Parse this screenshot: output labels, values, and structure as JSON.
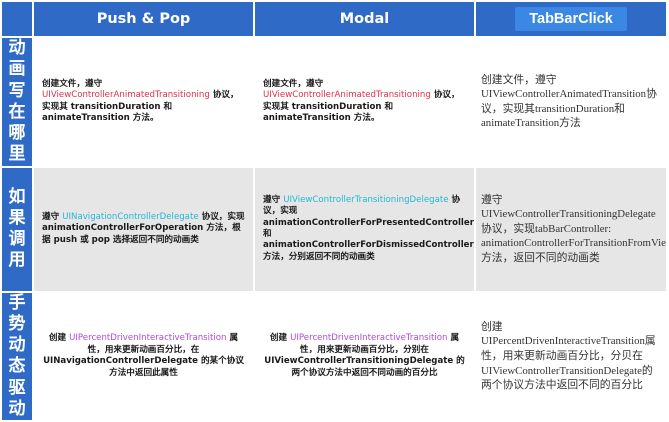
{
  "header": {
    "col1": "Push & Pop",
    "col2": "Modal",
    "col3": "TabBarClick"
  },
  "rows": [
    {
      "label": "动画写在哪里",
      "push_pre": "创建文件，遵守",
      "push_hl": "UIViewControllerAnimatedTransitioning",
      "push_post": "协议，实现其 transitionDuration 和 animateTransition 方法。",
      "modal_pre": "创建文件，遵守",
      "modal_hl": "UIViewControllerAnimatedTransitioning",
      "modal_post": "协议，实现其 transitionDuration 和 animateTransition 方法。",
      "tab": "创建文件，遵守UIViewControllerAnimatedTransition协议，实现其transitionDuration和animateTransition方法"
    },
    {
      "label": "如果调用",
      "push_pre": "遵守",
      "push_hl": "UINavigationControllerDelegate",
      "push_post": "协议，实现 animationControllerForOperation 方法，根据 push 或 pop 选择返回不同的动画类",
      "modal_pre": "遵守",
      "modal_hl": "UIViewControllerTransitioningDelegate",
      "modal_post": "协议，实现 animationControllerForPresentedController 和 animationControllerForDismissedController 方法，分别返回不同的动画类",
      "tab": "遵守UIViewControllerTransitioningDelegate协议，实现tabBarController: animationControllerForTransitionFromViewController: 方法，返回不同的动画类"
    },
    {
      "label": "手势动态驱动",
      "push_pre": "创建",
      "push_hl": "UIPercentDrivenInteractiveTransition",
      "push_post": "属性，用来更新动画百分比，在 UINavigationControllerDelegate 的某个协议方法中返回此属性",
      "modal_pre": "创建",
      "modal_hl": "UIPercentDrivenInteractiveTransition",
      "modal_post": "属性，用来更新动画百分比，分别在 UIViewControllerTransitioningDelegate 的两个协议方法中返回不同动画的百分比",
      "tab": "创建UIPercentDrivenInteractiveTransition属性，用来更新动画百分比，分贝在UIViewControllerTransitionDelegate的两个协议方法中返回不同的百分比"
    }
  ],
  "colors": {
    "header_bg": "#2f6bc6",
    "tab_button_bg": "#3a87e4",
    "highlight_red": "#e0304a",
    "highlight_purple": "#b04ad8",
    "highlight_cyan": "#20b8d8",
    "alt_row_bg": "#e6e6e6"
  }
}
